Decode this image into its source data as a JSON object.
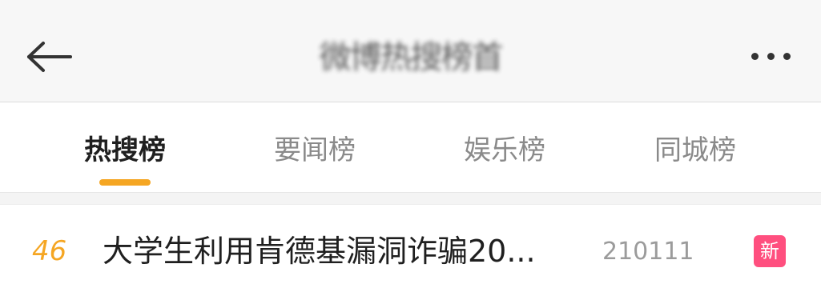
{
  "header": {
    "title": "微博热搜榜首"
  },
  "tabs": [
    {
      "label": "热搜榜",
      "active": true
    },
    {
      "label": "要闻榜",
      "active": false
    },
    {
      "label": "娱乐榜",
      "active": false
    },
    {
      "label": "同城榜",
      "active": false
    }
  ],
  "list": {
    "items": [
      {
        "rank": "46",
        "title": "大学生利用肯德基漏洞诈骗20...",
        "count": "210111",
        "badge": "新"
      }
    ]
  },
  "colors": {
    "accent": "#f5a623",
    "badge": "#ff4f7f",
    "header_bg": "#f7f7f7"
  },
  "icons": {
    "back": "arrow-left-icon",
    "more": "more-horizontal-icon"
  }
}
